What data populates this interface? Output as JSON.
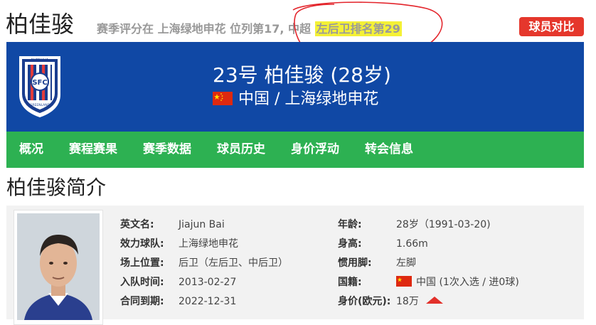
{
  "header": {
    "player_name": "柏佳骏",
    "summary_prefix": "赛季评分在 上海绿地申花 位列第17, 中超 ",
    "summary_highlight": "左后卫排名第29",
    "compare_button": "球员对比"
  },
  "banner": {
    "title": "23号 柏佳骏 (28岁)",
    "subtitle": "中国 / 上海绿地申花",
    "logo": {
      "top_text": "SHENHUA",
      "center_text": "SFC",
      "bottom_text": "GREENLAND"
    }
  },
  "nav": {
    "items": [
      "概况",
      "赛程赛果",
      "赛季数据",
      "球员历史",
      "身价浮动",
      "转会信息"
    ]
  },
  "section": {
    "title": "柏佳骏简介"
  },
  "info": {
    "english_name_label": "英文名:",
    "english_name": "Jiajun Bai",
    "club_label": "效力球队:",
    "club": "上海绿地申花",
    "position_label": "场上位置:",
    "position": "后卫（左后卫、中后卫）",
    "join_date_label": "入队时间:",
    "join_date": "2013-02-27",
    "contract_label": "合同到期:",
    "contract": "2022-12-31",
    "age_label": "年龄:",
    "age": "28岁（1991-03-20)",
    "height_label": "身高:",
    "height": "1.66m",
    "foot_label": "惯用脚:",
    "foot": "左脚",
    "nationality_label": "国籍:",
    "nationality": "中国 (1次入选 / 进0球)",
    "value_label": "身价(欧元):",
    "value": "18万",
    "value_trend": "up"
  },
  "colors": {
    "banner_blue": "#1048a5",
    "nav_green": "#2db152",
    "compare_red": "#e5372c",
    "highlight_yellow": "#f4f136",
    "annotation_red": "#e3242b"
  },
  "icons": [
    "club-logo-icon",
    "china-flag-icon",
    "up-arrow-icon"
  ]
}
